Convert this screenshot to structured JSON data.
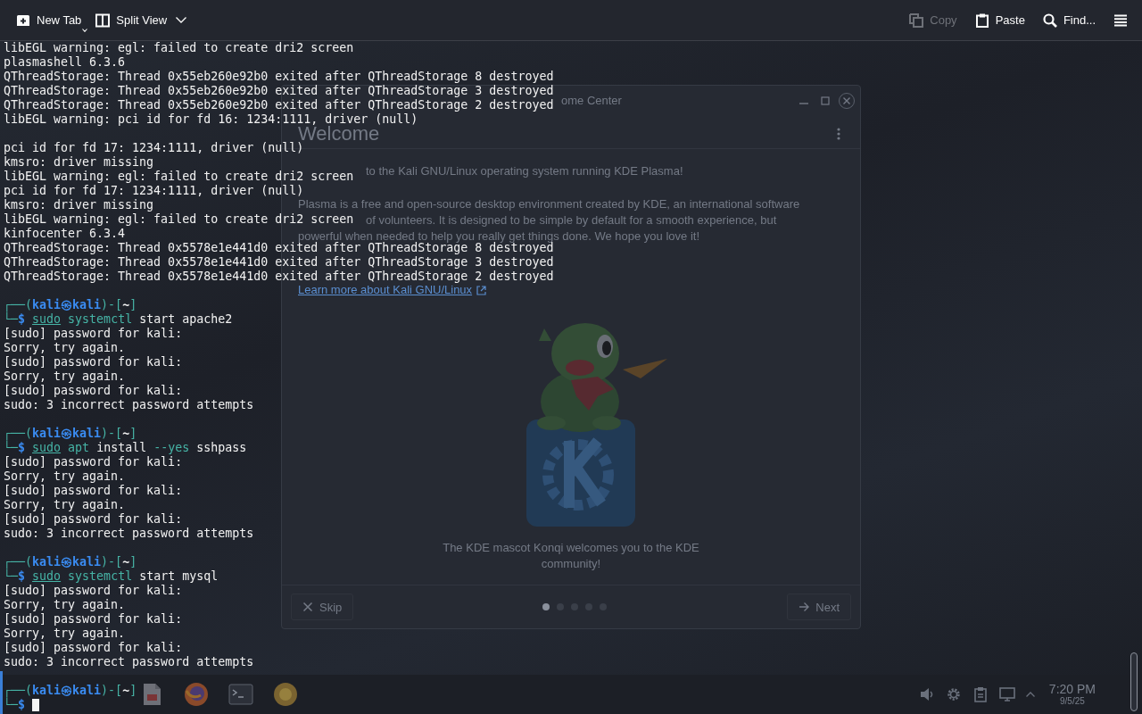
{
  "toolbar": {
    "left": [
      {
        "kind": "new-tab",
        "label": "New Tab",
        "menu_indicator": true
      },
      {
        "kind": "split-view",
        "label": "Split View"
      },
      {
        "kind": "dropdown"
      }
    ],
    "right": [
      {
        "kind": "copy",
        "label": "Copy",
        "disabled": true
      },
      {
        "kind": "paste",
        "label": "Paste",
        "disabled": false
      },
      {
        "kind": "find",
        "label": "Find..."
      },
      {
        "kind": "menu"
      }
    ]
  },
  "terminal": {
    "lines": [
      {
        "kind": "output",
        "text": "libEGL warning: egl: failed to create dri2 screen"
      },
      {
        "kind": "output",
        "text": "plasmashell 6.3.6"
      },
      {
        "kind": "output",
        "text": "QThreadStorage: Thread 0x55eb260e92b0 exited after QThreadStorage 8 destroyed"
      },
      {
        "kind": "output",
        "text": "QThreadStorage: Thread 0x55eb260e92b0 exited after QThreadStorage 3 destroyed"
      },
      {
        "kind": "output",
        "text": "QThreadStorage: Thread 0x55eb260e92b0 exited after QThreadStorage 2 destroyed"
      },
      {
        "kind": "output",
        "text": "libEGL warning: pci id for fd 16: 1234:1111, driver (null)"
      },
      {
        "kind": "blank"
      },
      {
        "kind": "output",
        "text": "pci id for fd 17: 1234:1111, driver (null)"
      },
      {
        "kind": "output",
        "text": "kmsro: driver missing"
      },
      {
        "kind": "output",
        "text": "libEGL warning: egl: failed to create dri2 screen"
      },
      {
        "kind": "output",
        "text": "pci id for fd 17: 1234:1111, driver (null)"
      },
      {
        "kind": "output",
        "text": "kmsro: driver missing"
      },
      {
        "kind": "output",
        "text": "libEGL warning: egl: failed to create dri2 screen"
      },
      {
        "kind": "output",
        "text": "kinfocenter 6.3.4"
      },
      {
        "kind": "output",
        "text": "QThreadStorage: Thread 0x5578e1e441d0 exited after QThreadStorage 8 destroyed"
      },
      {
        "kind": "output",
        "text": "QThreadStorage: Thread 0x5578e1e441d0 exited after QThreadStorage 3 destroyed"
      },
      {
        "kind": "output",
        "text": "QThreadStorage: Thread 0x5578e1e441d0 exited after QThreadStorage 2 destroyed"
      },
      {
        "kind": "blank"
      },
      {
        "kind": "prompt",
        "frame_open": "┌──(",
        "user": "kali",
        "at": "㉿",
        "host": "kali",
        "frame_mid": ")-[",
        "dir": "~",
        "frame_close": "]"
      },
      {
        "kind": "command",
        "corner": "└─",
        "sigil": "$",
        "tokens": [
          {
            "text": "sudo",
            "kind": "precommand"
          },
          {
            "text": "systemctl",
            "kind": "command"
          },
          {
            "text": "start apache2",
            "kind": "arg"
          }
        ],
        "cursor": false
      },
      {
        "kind": "output",
        "text": "[sudo] password for kali:"
      },
      {
        "kind": "output",
        "text": "Sorry, try again."
      },
      {
        "kind": "output",
        "text": "[sudo] password for kali:"
      },
      {
        "kind": "output",
        "text": "Sorry, try again."
      },
      {
        "kind": "output",
        "text": "[sudo] password for kali:"
      },
      {
        "kind": "output",
        "text": "sudo: 3 incorrect password attempts"
      },
      {
        "kind": "blank"
      },
      {
        "kind": "prompt",
        "frame_open": "┌──(",
        "user": "kali",
        "at": "㉿",
        "host": "kali",
        "frame_mid": ")-[",
        "dir": "~",
        "frame_close": "]"
      },
      {
        "kind": "command",
        "corner": "└─",
        "sigil": "$",
        "tokens": [
          {
            "text": "sudo",
            "kind": "precommand"
          },
          {
            "text": "apt",
            "kind": "command"
          },
          {
            "text": "install",
            "kind": "arg"
          },
          {
            "text": "--yes",
            "kind": "option"
          },
          {
            "text": "sshpass",
            "kind": "arg"
          }
        ],
        "cursor": false
      },
      {
        "kind": "output",
        "text": "[sudo] password for kali:"
      },
      {
        "kind": "output",
        "text": "Sorry, try again."
      },
      {
        "kind": "output",
        "text": "[sudo] password for kali:"
      },
      {
        "kind": "output",
        "text": "Sorry, try again."
      },
      {
        "kind": "output",
        "text": "[sudo] password for kali:"
      },
      {
        "kind": "output",
        "text": "sudo: 3 incorrect password attempts"
      },
      {
        "kind": "blank"
      },
      {
        "kind": "prompt",
        "frame_open": "┌──(",
        "user": "kali",
        "at": "㉿",
        "host": "kali",
        "frame_mid": ")-[",
        "dir": "~",
        "frame_close": "]"
      },
      {
        "kind": "command",
        "corner": "└─",
        "sigil": "$",
        "tokens": [
          {
            "text": "sudo",
            "kind": "precommand"
          },
          {
            "text": "systemctl",
            "kind": "command"
          },
          {
            "text": "start mysql",
            "kind": "arg"
          }
        ],
        "cursor": false
      },
      {
        "kind": "output",
        "text": "[sudo] password for kali:"
      },
      {
        "kind": "output",
        "text": "Sorry, try again."
      },
      {
        "kind": "output",
        "text": "[sudo] password for kali:"
      },
      {
        "kind": "output",
        "text": "Sorry, try again."
      },
      {
        "kind": "output",
        "text": "[sudo] password for kali:"
      },
      {
        "kind": "output",
        "text": "sudo: 3 incorrect password attempts"
      },
      {
        "kind": "blank"
      },
      {
        "kind": "prompt",
        "frame_open": "┌──(",
        "user": "kali",
        "at": "㉿",
        "host": "kali",
        "frame_mid": ")-[",
        "dir": "~",
        "frame_close": "]"
      },
      {
        "kind": "command",
        "corner": "└─",
        "sigil": "$",
        "cursor": true
      }
    ]
  },
  "background_window": {
    "title": "ome Center",
    "heading": "Welcome",
    "intro": {
      "text": "to the Kali GNU/Linux operating system running KDE Plasma!",
      "covered": true
    },
    "body_lines": [
      {
        "text": "Plasma is a free and open-source desktop environment created by KDE, an international software",
        "covered": false
      },
      {
        "text": "of volunteers. It is designed to be simple by default for a smooth experience, but",
        "covered": true
      },
      {
        "text": "powerful when needed to help you really get things done. We hope you love it!",
        "covered": false
      }
    ],
    "link": "Learn more about Kali GNU/Linux",
    "caption": "The KDE mascot Konqi welcomes you to the KDE community!",
    "skip": "Skip",
    "next": "Next",
    "pages": [
      {
        "selected": true
      },
      {
        "selected": false
      },
      {
        "selected": false
      },
      {
        "selected": false
      },
      {
        "selected": false
      }
    ]
  },
  "taskbar": {
    "apps": [
      {
        "kind": "document"
      },
      {
        "kind": "browser"
      },
      {
        "kind": "terminal"
      },
      {
        "kind": "disc"
      }
    ],
    "tray": [
      {
        "kind": "speaker"
      },
      {
        "kind": "gear"
      },
      {
        "kind": "clipboard"
      },
      {
        "kind": "monitor"
      },
      {
        "kind": "expand"
      }
    ],
    "time": "7:20 PM",
    "date": "9/5/25"
  }
}
